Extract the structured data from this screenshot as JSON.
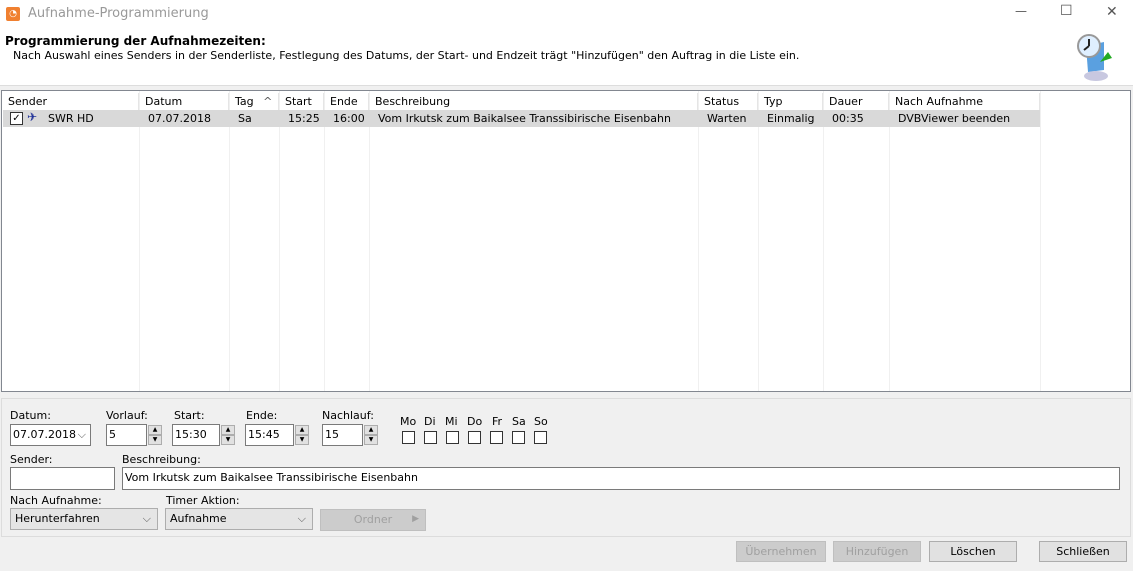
{
  "window": {
    "title": "Aufnahme-Programmierung",
    "minimize": "—",
    "maximize": "☐",
    "close": "✕"
  },
  "header": {
    "title": "Programmierung der Aufnahmezeiten:",
    "description": "Nach Auswahl eines Senders in der Senderliste, Festlegung des Datums, der Start- und Endzeit trägt \"Hinzufügen\" den Auftrag in die Liste ein."
  },
  "list": {
    "columns": [
      "Sender",
      "Datum",
      "Tag",
      "Start",
      "Ende",
      "Beschreibung",
      "Status",
      "Typ",
      "Dauer",
      "Nach Aufnahme"
    ],
    "sort_indicator": "^",
    "rows": [
      {
        "checked": true,
        "sender": "SWR HD",
        "datum": "07.07.2018",
        "tag": "Sa",
        "start": "15:25",
        "ende": "16:00",
        "beschreibung": "Vom Irkutsk zum Baikalsee Transsibirische Eisenbahn",
        "status": "Warten",
        "typ": "Einmalig",
        "dauer": "00:35",
        "nach": "DVBViewer beenden"
      }
    ]
  },
  "form": {
    "datum_label": "Datum:",
    "datum": "07.07.2018",
    "vorlauf_label": "Vorlauf:",
    "vorlauf": "5",
    "start_label": "Start:",
    "start": "15:30",
    "ende_label": "Ende:",
    "ende": "15:45",
    "nachlauf_label": "Nachlauf:",
    "nachlauf": "15",
    "days": [
      "Mo",
      "Di",
      "Mi",
      "Do",
      "Fr",
      "Sa",
      "So"
    ],
    "sender_label": "Sender:",
    "sender": "",
    "beschreibung_label": "Beschreibung:",
    "beschreibung": "Vom Irkutsk zum Baikalsee Transsibirische Eisenbahn",
    "nach_label": "Nach Aufnahme:",
    "nach": "Herunterfahren",
    "timer_label": "Timer Aktion:",
    "timer": "Aufnahme",
    "ordner": "Ordner"
  },
  "buttons": {
    "uebernehmen": "Übernehmen",
    "hinzufuegen": "Hinzufügen",
    "loeschen": "Löschen",
    "schliessen": "Schließen"
  }
}
